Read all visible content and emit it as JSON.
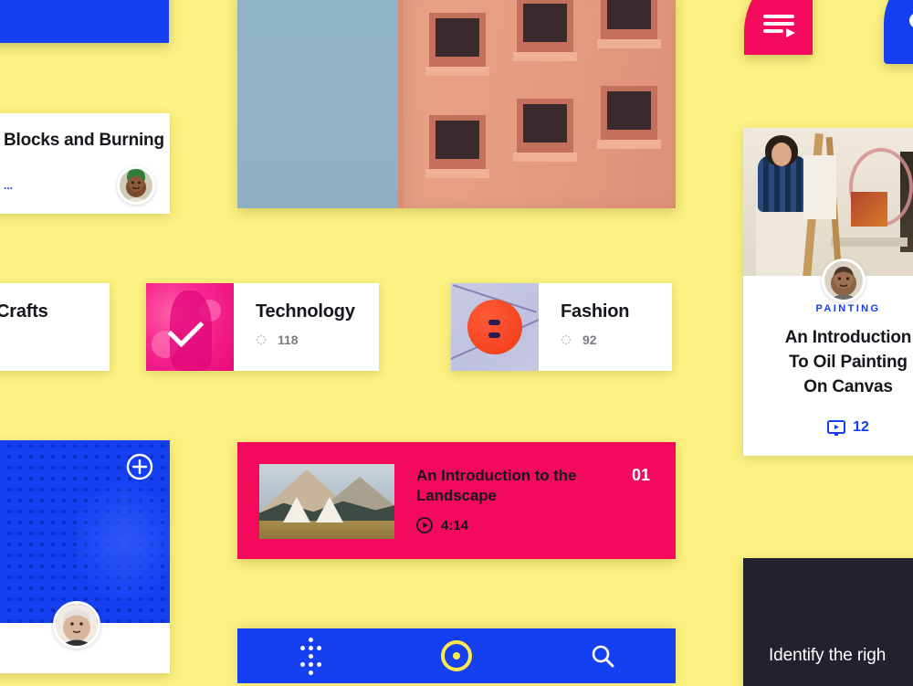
{
  "theme": {
    "background": "#FCF281",
    "pink": "#F40A5C",
    "blue": "#1540F2",
    "dark": "#22222E",
    "ink": "#16161D"
  },
  "blue_top_card": {
    "icon": "cursor-arrow-icon"
  },
  "hero": {
    "name": "hero-building-photo"
  },
  "playlist_fab": {
    "icon": "playlist-play-icon"
  },
  "blue_corner": {
    "icon": "circle-dot-icon"
  },
  "blocks_card": {
    "title": "Blocks and Burning",
    "subtitle": "...",
    "avatar": "instructor-avatar"
  },
  "categories": [
    {
      "name": "Crafts",
      "count": "",
      "thumb": "crafts-thumbnail",
      "selected": false
    },
    {
      "name": "Technology",
      "count": "118",
      "thumb": "technology-thumbnail",
      "selected": true
    },
    {
      "name": "Fashion",
      "count": "92",
      "thumb": "fashion-thumbnail",
      "selected": false
    }
  ],
  "painting_card": {
    "kicker": "PAINTING",
    "title_line1": "An Introduction",
    "title_line2": "To Oil Painting",
    "title_line3": "On Canvas",
    "lessons_count": "12",
    "lessons_icon": "screen-play-icon",
    "photo": "oil-painting-studio-photo",
    "avatar": "course-author-avatar"
  },
  "lesson_row": {
    "title": "An Introduction to the Landscape",
    "duration": "4:14",
    "duration_icon": "play-circle-icon",
    "number": "01",
    "thumb": "landscape-mountains-thumbnail"
  },
  "dots_card": {
    "add_icon": "plus-circle-icon",
    "avatar": "member-avatar",
    "media": "halftone-dot-pattern"
  },
  "dark_card": {
    "title": "Identify the righ"
  },
  "bottom_nav": {
    "items": [
      {
        "name": "dots-grid-icon",
        "label": ""
      },
      {
        "name": "record-target-icon",
        "label": ""
      },
      {
        "name": "search-icon",
        "label": ""
      }
    ]
  }
}
